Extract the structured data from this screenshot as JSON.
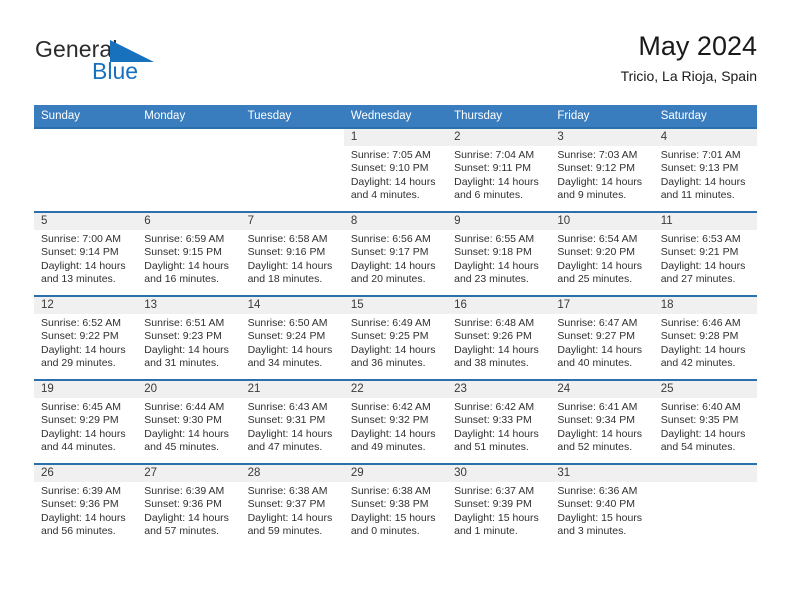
{
  "brand": {
    "name_top": "General",
    "name_bottom": "Blue",
    "triangle_icon": "blue-triangle-logo",
    "accent_color": "#1771bd"
  },
  "header": {
    "title": "May 2024",
    "subtitle": "Tricio, La Rioja, Spain"
  },
  "colors": {
    "header_band": "#3a7dbf",
    "row_border": "#2b6fae",
    "daynum_band": "#f0f0f0"
  },
  "weekdays": [
    "Sunday",
    "Monday",
    "Tuesday",
    "Wednesday",
    "Thursday",
    "Friday",
    "Saturday"
  ],
  "labels": {
    "sunrise_prefix": "Sunrise:",
    "sunset_prefix": "Sunset:",
    "daylight_prefix": "Daylight:"
  },
  "weeks": [
    [
      {
        "day": "",
        "blank": true
      },
      {
        "day": "",
        "blank": true
      },
      {
        "day": "",
        "blank": true
      },
      {
        "day": "1",
        "sunrise": "Sunrise: 7:05 AM",
        "sunset": "Sunset: 9:10 PM",
        "daylight": "Daylight: 14 hours and 4 minutes."
      },
      {
        "day": "2",
        "sunrise": "Sunrise: 7:04 AM",
        "sunset": "Sunset: 9:11 PM",
        "daylight": "Daylight: 14 hours and 6 minutes."
      },
      {
        "day": "3",
        "sunrise": "Sunrise: 7:03 AM",
        "sunset": "Sunset: 9:12 PM",
        "daylight": "Daylight: 14 hours and 9 minutes."
      },
      {
        "day": "4",
        "sunrise": "Sunrise: 7:01 AM",
        "sunset": "Sunset: 9:13 PM",
        "daylight": "Daylight: 14 hours and 11 minutes."
      }
    ],
    [
      {
        "day": "5",
        "sunrise": "Sunrise: 7:00 AM",
        "sunset": "Sunset: 9:14 PM",
        "daylight": "Daylight: 14 hours and 13 minutes."
      },
      {
        "day": "6",
        "sunrise": "Sunrise: 6:59 AM",
        "sunset": "Sunset: 9:15 PM",
        "daylight": "Daylight: 14 hours and 16 minutes."
      },
      {
        "day": "7",
        "sunrise": "Sunrise: 6:58 AM",
        "sunset": "Sunset: 9:16 PM",
        "daylight": "Daylight: 14 hours and 18 minutes."
      },
      {
        "day": "8",
        "sunrise": "Sunrise: 6:56 AM",
        "sunset": "Sunset: 9:17 PM",
        "daylight": "Daylight: 14 hours and 20 minutes."
      },
      {
        "day": "9",
        "sunrise": "Sunrise: 6:55 AM",
        "sunset": "Sunset: 9:18 PM",
        "daylight": "Daylight: 14 hours and 23 minutes."
      },
      {
        "day": "10",
        "sunrise": "Sunrise: 6:54 AM",
        "sunset": "Sunset: 9:20 PM",
        "daylight": "Daylight: 14 hours and 25 minutes."
      },
      {
        "day": "11",
        "sunrise": "Sunrise: 6:53 AM",
        "sunset": "Sunset: 9:21 PM",
        "daylight": "Daylight: 14 hours and 27 minutes."
      }
    ],
    [
      {
        "day": "12",
        "sunrise": "Sunrise: 6:52 AM",
        "sunset": "Sunset: 9:22 PM",
        "daylight": "Daylight: 14 hours and 29 minutes."
      },
      {
        "day": "13",
        "sunrise": "Sunrise: 6:51 AM",
        "sunset": "Sunset: 9:23 PM",
        "daylight": "Daylight: 14 hours and 31 minutes."
      },
      {
        "day": "14",
        "sunrise": "Sunrise: 6:50 AM",
        "sunset": "Sunset: 9:24 PM",
        "daylight": "Daylight: 14 hours and 34 minutes."
      },
      {
        "day": "15",
        "sunrise": "Sunrise: 6:49 AM",
        "sunset": "Sunset: 9:25 PM",
        "daylight": "Daylight: 14 hours and 36 minutes."
      },
      {
        "day": "16",
        "sunrise": "Sunrise: 6:48 AM",
        "sunset": "Sunset: 9:26 PM",
        "daylight": "Daylight: 14 hours and 38 minutes."
      },
      {
        "day": "17",
        "sunrise": "Sunrise: 6:47 AM",
        "sunset": "Sunset: 9:27 PM",
        "daylight": "Daylight: 14 hours and 40 minutes."
      },
      {
        "day": "18",
        "sunrise": "Sunrise: 6:46 AM",
        "sunset": "Sunset: 9:28 PM",
        "daylight": "Daylight: 14 hours and 42 minutes."
      }
    ],
    [
      {
        "day": "19",
        "sunrise": "Sunrise: 6:45 AM",
        "sunset": "Sunset: 9:29 PM",
        "daylight": "Daylight: 14 hours and 44 minutes."
      },
      {
        "day": "20",
        "sunrise": "Sunrise: 6:44 AM",
        "sunset": "Sunset: 9:30 PM",
        "daylight": "Daylight: 14 hours and 45 minutes."
      },
      {
        "day": "21",
        "sunrise": "Sunrise: 6:43 AM",
        "sunset": "Sunset: 9:31 PM",
        "daylight": "Daylight: 14 hours and 47 minutes."
      },
      {
        "day": "22",
        "sunrise": "Sunrise: 6:42 AM",
        "sunset": "Sunset: 9:32 PM",
        "daylight": "Daylight: 14 hours and 49 minutes."
      },
      {
        "day": "23",
        "sunrise": "Sunrise: 6:42 AM",
        "sunset": "Sunset: 9:33 PM",
        "daylight": "Daylight: 14 hours and 51 minutes."
      },
      {
        "day": "24",
        "sunrise": "Sunrise: 6:41 AM",
        "sunset": "Sunset: 9:34 PM",
        "daylight": "Daylight: 14 hours and 52 minutes."
      },
      {
        "day": "25",
        "sunrise": "Sunrise: 6:40 AM",
        "sunset": "Sunset: 9:35 PM",
        "daylight": "Daylight: 14 hours and 54 minutes."
      }
    ],
    [
      {
        "day": "26",
        "sunrise": "Sunrise: 6:39 AM",
        "sunset": "Sunset: 9:36 PM",
        "daylight": "Daylight: 14 hours and 56 minutes."
      },
      {
        "day": "27",
        "sunrise": "Sunrise: 6:39 AM",
        "sunset": "Sunset: 9:36 PM",
        "daylight": "Daylight: 14 hours and 57 minutes."
      },
      {
        "day": "28",
        "sunrise": "Sunrise: 6:38 AM",
        "sunset": "Sunset: 9:37 PM",
        "daylight": "Daylight: 14 hours and 59 minutes."
      },
      {
        "day": "29",
        "sunrise": "Sunrise: 6:38 AM",
        "sunset": "Sunset: 9:38 PM",
        "daylight": "Daylight: 15 hours and 0 minutes."
      },
      {
        "day": "30",
        "sunrise": "Sunrise: 6:37 AM",
        "sunset": "Sunset: 9:39 PM",
        "daylight": "Daylight: 15 hours and 1 minute."
      },
      {
        "day": "31",
        "sunrise": "Sunrise: 6:36 AM",
        "sunset": "Sunset: 9:40 PM",
        "daylight": "Daylight: 15 hours and 3 minutes."
      },
      {
        "day": "",
        "empty": true
      }
    ]
  ]
}
